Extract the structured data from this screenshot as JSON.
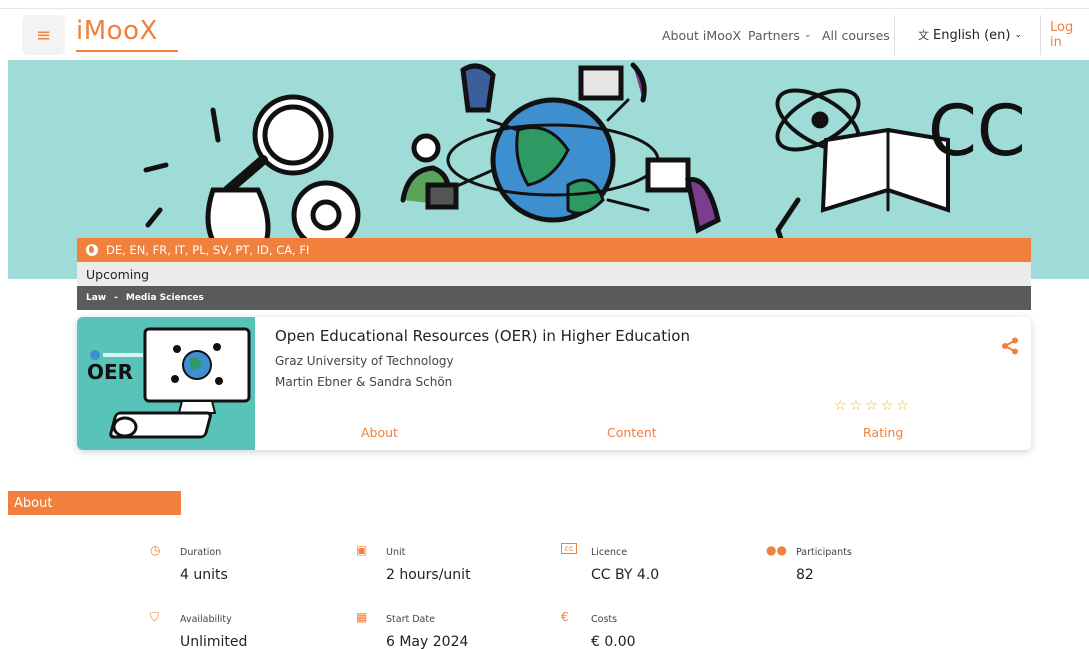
{
  "navbar": {
    "logo": "iMooX",
    "about": "About iMooX",
    "partners": "Partners",
    "all_courses": "All courses",
    "language": "English (en)",
    "login": "Log in"
  },
  "course": {
    "languages": "DE, EN, FR, IT, PL, SV, PT, ID, CA, FI",
    "status": "Upcoming",
    "categories": [
      "Law",
      "Media Sciences"
    ],
    "title": "Open Educational Resources (OER) in Higher Education",
    "university": "Graz University of Technology",
    "authors": "Martin Ebner & Sandra Schön",
    "thumbnail_label": "OER",
    "rating": 0,
    "tabs": {
      "about": "About",
      "content": "Content",
      "rating": "Rating"
    }
  },
  "about": {
    "heading": "About",
    "items": [
      {
        "label": "Duration",
        "value": "4 units",
        "icon": "clock-icon"
      },
      {
        "label": "Unit",
        "value": "2 hours/unit",
        "icon": "video-icon"
      },
      {
        "label": "Licence",
        "value": "CC BY 4.0",
        "icon": "cc-icon"
      },
      {
        "label": "Participants",
        "value": "82",
        "icon": "users-icon"
      },
      {
        "label": "Availability",
        "value": "Unlimited",
        "icon": "shield-icon"
      },
      {
        "label": "Start Date",
        "value": "6 May 2024",
        "icon": "calendar-icon"
      },
      {
        "label": "Costs",
        "value": "€ 0.00",
        "icon": "euro-icon"
      }
    ]
  },
  "colors": {
    "accent": "#f0803c",
    "hero_bg": "#9fdcd8",
    "category_bar": "#5b5b5b",
    "status_bar": "#ebebeb",
    "star": "#f2b705"
  }
}
